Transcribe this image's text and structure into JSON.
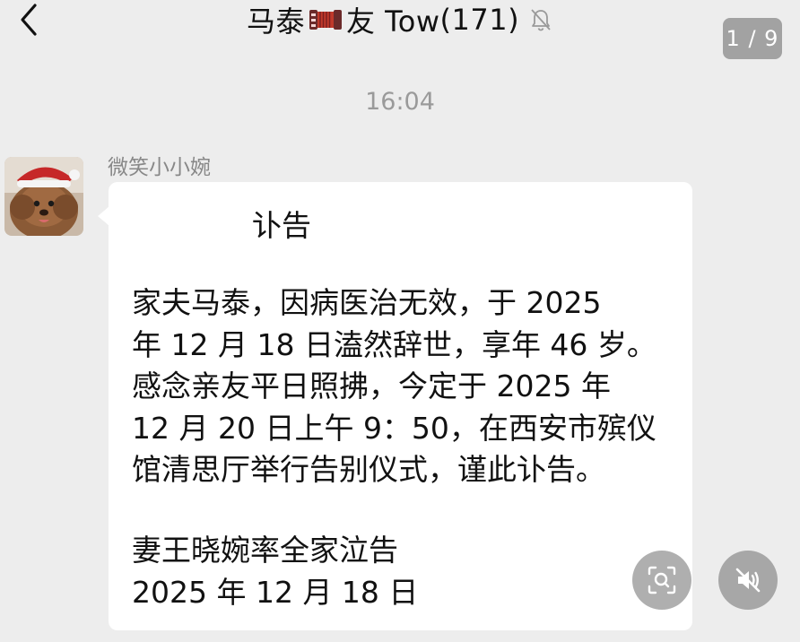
{
  "header": {
    "back_icon": "chevron-left-icon",
    "title_prefix": "马泰",
    "title_emoji": "accordion-emoji",
    "title_suffix": "友 Tow",
    "member_count": "(171)",
    "mute_icon": "bell-muted-icon"
  },
  "page_indicator": "1 / 9",
  "timestamp": "16:04",
  "message": {
    "sender": "微笑小小婉",
    "avatar": "dog-with-santa-hat-avatar",
    "heading": "讣告",
    "body_lines": [
      "家夫马泰，因病医治无效，于 2025",
      "年 12 月 18 日溘然辞世，享年 46 岁。",
      "感念亲友平日照拂，今定于 2025 年",
      "12 月 20 日上午 9：50，在西安市殡仪",
      "馆清思厅举行告别仪式，谨此讣告。"
    ],
    "signature_lines": [
      "妻王晓婉率全家泣告",
      "2025 年 12 月 18 日"
    ]
  },
  "overlay_buttons": {
    "scan_icon": "image-search-icon",
    "audio_icon": "speaker-muted-icon"
  },
  "colors": {
    "background": "#ededed",
    "bubble": "#ffffff",
    "timestamp": "#9a9a9a"
  }
}
